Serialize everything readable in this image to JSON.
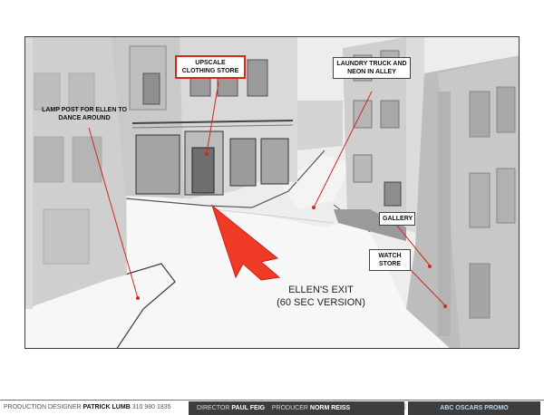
{
  "callouts": {
    "upscale": "UPSCALE CLOTHING STORE",
    "laundry": "LAUNDRY TRUCK AND NEON IN ALLEY",
    "lamp": "LAMP POST FOR ELLEN TO DANCE AROUND",
    "gallery": "GALLERY",
    "watch": "WATCH STORE"
  },
  "exit_label": {
    "line1": "ELLEN'S EXIT",
    "line2": "(60 SEC VERSION)"
  },
  "footer": {
    "production_designer_label": "PRODUCTION DESIGNER",
    "production_designer_name": "PATRICK LUMB",
    "phone": "310 980 1835",
    "director_label": "DIRECTOR",
    "director_name": "PAUL FEIG",
    "producer_label": "PRODUCER",
    "producer_name": "NORM REISS",
    "separator": "|",
    "project": "ABC OSCARS PROMO"
  },
  "colors": {
    "accent_red": "#d8261d",
    "footer_bar": "#3d3d3d",
    "project_text": "#b9d6f0"
  }
}
